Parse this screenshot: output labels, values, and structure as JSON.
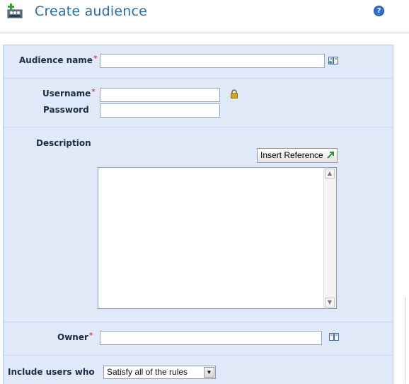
{
  "header": {
    "title": "Create audience",
    "help_icon": "help-icon",
    "help_glyph": "?",
    "app_icon": "audience-icon"
  },
  "form": {
    "audience_name": {
      "label": "Audience name",
      "required": "*",
      "value": "",
      "lookup_icon": "address-book-icon"
    },
    "username": {
      "label": "Username",
      "required": "*",
      "value": "",
      "lock_icon": "lock-icon"
    },
    "password": {
      "label": "Password",
      "value": ""
    },
    "description": {
      "label": "Description",
      "insert_reference_label": "Insert Reference",
      "value": ""
    },
    "owner": {
      "label": "Owner",
      "required": "*",
      "value": "",
      "lookup_icon": "address-book-icon"
    },
    "include_users": {
      "label": "Include users who",
      "selected": "Satisfy all of the rules"
    }
  },
  "colors": {
    "title": "#2b6fa3",
    "panel_bg": "#dfe9f7",
    "required": "#c8102e"
  }
}
